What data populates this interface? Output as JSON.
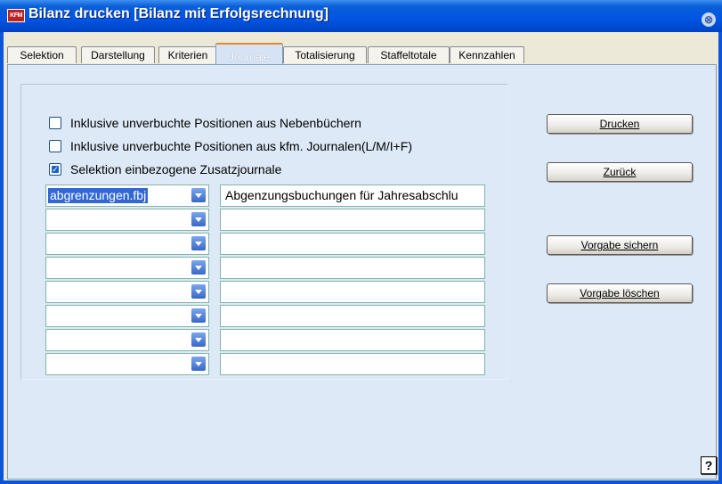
{
  "window": {
    "app_icon_text": "KFM",
    "title": "Bilanz drucken [Bilanz mit Erfolgsrechnung]",
    "close_glyph": "⊗"
  },
  "tabs": [
    {
      "label": "Selektion"
    },
    {
      "label": "Darstellung"
    },
    {
      "label": "Kriterien"
    },
    {
      "label": "Journale"
    },
    {
      "label": "Totalisierung"
    },
    {
      "label": "Staffeltotale"
    },
    {
      "label": "Kennzahlen"
    }
  ],
  "active_tab": "Journale",
  "options": [
    {
      "label": "Inklusive unverbuchte Positionen aus Nebenbüchern",
      "checked": false
    },
    {
      "label": "Inklusive unverbuchte Positionen aus kfm. Journalen(L/M/I+F)",
      "checked": false
    },
    {
      "label": "Selektion einbezogene Zusatzjournale",
      "checked": true
    }
  ],
  "journals": [
    {
      "file": "abgrenzungen.fbj",
      "description": "Abgenzungsbuchungen für Jahresabschlu"
    },
    {
      "file": "",
      "description": ""
    },
    {
      "file": "",
      "description": ""
    },
    {
      "file": "",
      "description": ""
    },
    {
      "file": "",
      "description": ""
    },
    {
      "file": "",
      "description": ""
    },
    {
      "file": "",
      "description": ""
    },
    {
      "file": "",
      "description": ""
    }
  ],
  "buttons": {
    "print": "Drucken",
    "back": "Zurück",
    "save_default": "Vorgabe sichern",
    "delete_default": "Vorgabe löschen"
  },
  "help_label": "?",
  "colors": {
    "titlebar": "#0054e3",
    "content_bg": "#dde9f6",
    "selection": "#3168d5",
    "active_tab_accent": "#e68b2c"
  }
}
